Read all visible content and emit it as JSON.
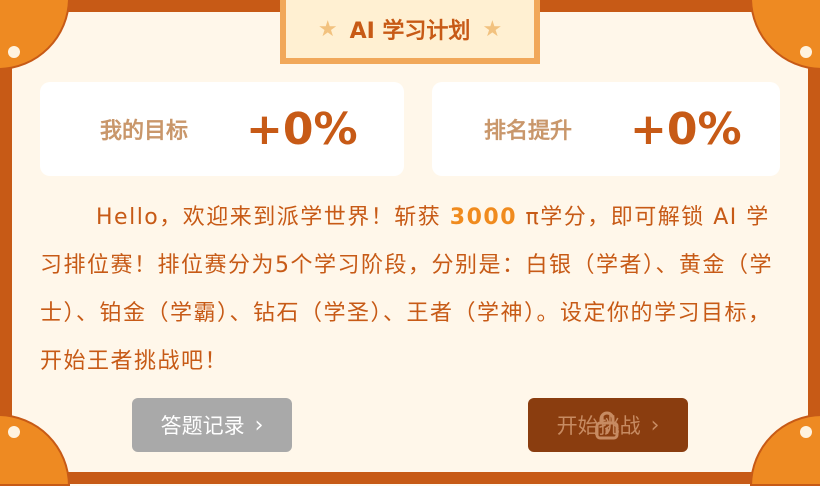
{
  "banner": {
    "title": "AI 学习计划",
    "star_icon": "star-icon"
  },
  "cards": [
    {
      "label": "我的目标",
      "value": "+0%"
    },
    {
      "label": "排名提升",
      "value": "+0%"
    }
  ],
  "description": {
    "part1": "Hello，欢迎来到派学世界！斩获 ",
    "points": "3000",
    "part2": " π学分，即可解锁 AI 学习排位赛！排位赛分为5个学习阶段，分别是：白银（学者）、黄金（学士）、铂金（学霸）、钻石（学圣）、王者（学神）。设定你的学习目标，开始王者挑战吧！"
  },
  "buttons": {
    "records": "答题记录",
    "challenge": "开始挑战"
  },
  "colors": {
    "border": "#c75a16",
    "accent": "#ee8a22",
    "text": "#c75a16",
    "highlight": "#f08b1e"
  }
}
